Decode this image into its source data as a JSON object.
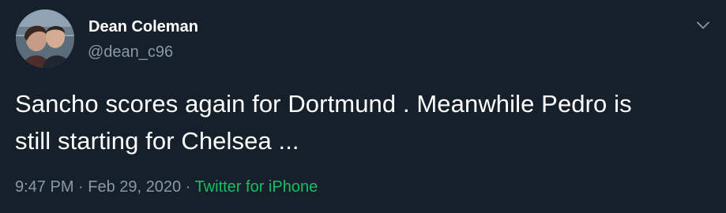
{
  "user": {
    "display_name": "Dean Coleman",
    "handle": "@dean_c96"
  },
  "tweet": {
    "text_line1": "Sancho scores again for Dortmund . Meanwhile Pedro is",
    "text_line2": "still starting for Chelsea ..."
  },
  "meta": {
    "time": "9:47 PM",
    "separator1": " · ",
    "date": "Feb 29, 2020",
    "separator2": " · ",
    "source": "Twitter for iPhone"
  },
  "icons": {
    "avatar": "avatar",
    "caret": "chevron-down-icon"
  },
  "colors": {
    "background": "#15202b",
    "primary_text": "#ffffff",
    "secondary_text": "#8899a6",
    "source_link": "#17bf63"
  }
}
